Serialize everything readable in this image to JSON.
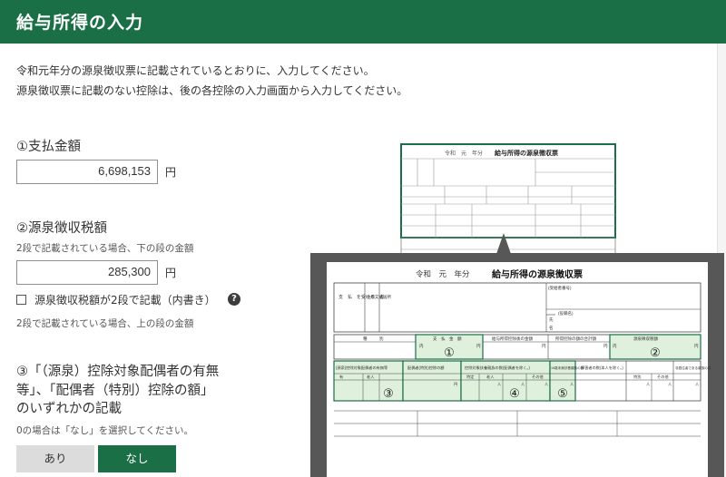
{
  "header": {
    "title": "給与所得の入力"
  },
  "intro": {
    "line1": "令和元年分の源泉徴収票に記載されているとおりに、入力してください。",
    "line2": "源泉徴収票に記載のない控除は、後の各控除の入力画面から入力してください。"
  },
  "q1": {
    "title": "①支払金額",
    "value": "6,698,153",
    "unit": "円"
  },
  "q2": {
    "title": "②源泉徴収税額",
    "note": "2段で記載されている場合、下の段の金額",
    "value": "285,300",
    "unit": "円",
    "checkbox_label": "源泉徴収税額が2段で記載（内書き）",
    "help_icon": "?",
    "checkbox_note": "2段で記載されている場合、上の段の金額"
  },
  "q3": {
    "line1": "③「（源泉）控除対象配偶者の有無",
    "line2": "等」、「配偶者（特別）控除の額」",
    "line3": "のいずれかの記載",
    "note": "0の場合は「なし」を選択してください。",
    "btn_ari": "あり",
    "btn_nashi": "なし"
  },
  "illustration": {
    "small_header": "令和　元　年分",
    "small_title": "給与所得の源泉徴収票",
    "big_header": "令和　元　年分",
    "big_title": "給与所得の源泉徴収票",
    "payee_address": "支　払　を受ける　者",
    "payee_address_sub": "住所又は居所",
    "id_label": "(受給者番号)",
    "role_label": "(役職名)",
    "name_label": "氏",
    "name_label2": "名",
    "kana_label": "(フリガナ)",
    "col_type": "種　　　別",
    "col_pay": "支　払　金　額",
    "col_after": "給与所得控除後の金額",
    "col_deduct": "所得控除の額の合計額",
    "col_tax": "源泉徴収税額",
    "yen": "円",
    "uchi": "内",
    "spouse_exist": "(源泉)控除対象配偶者の有無等",
    "spouse_amount": "配偶者(特別)控除の額",
    "dependents": "控除対象扶養親族の数(配偶者を除く。)",
    "disabled": "障害者の数(本人を除く。)",
    "nonresident": "非居住者である親族の数",
    "u16": "16歳未満扶養親族の数",
    "yes": "有",
    "old": "老人",
    "specific": "特定",
    "other": "その他",
    "people": "人",
    "special": "特別",
    "marker1": "①",
    "marker2": "②",
    "marker3": "③",
    "marker4": "④",
    "marker5": "⑤"
  },
  "colors": {
    "brand": "#1a6f46",
    "highlight": "#dff0dd",
    "frame": "#575757"
  }
}
